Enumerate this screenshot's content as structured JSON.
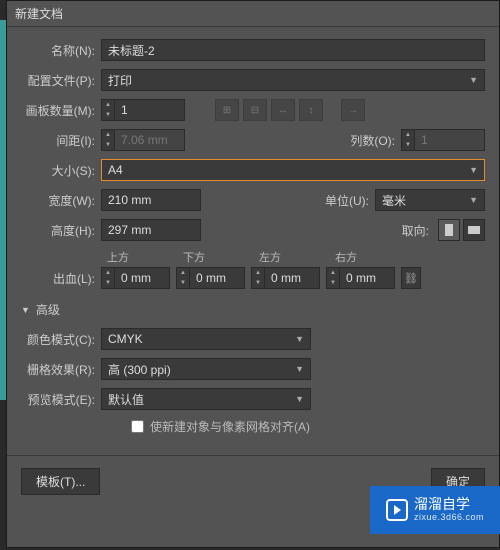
{
  "window": {
    "title": "新建文档"
  },
  "fields": {
    "name_label": "名称(N):",
    "name_value": "未标题-2",
    "profile_label": "配置文件(P):",
    "profile_value": "打印",
    "artboards_label": "画板数量(M):",
    "artboards_value": "1",
    "spacing_label": "间距(I):",
    "spacing_value": "7.06 mm",
    "columns_label": "列数(O):",
    "columns_value": "1",
    "size_label": "大小(S):",
    "size_value": "A4",
    "width_label": "宽度(W):",
    "width_value": "210 mm",
    "units_label": "单位(U):",
    "units_value": "毫米",
    "height_label": "高度(H):",
    "height_value": "297 mm",
    "orient_label": "取向:",
    "bleed_label": "出血(L):",
    "bleed_top_label": "上方",
    "bleed_bottom_label": "下方",
    "bleed_left_label": "左方",
    "bleed_right_label": "右方",
    "bleed_top": "0 mm",
    "bleed_bottom": "0 mm",
    "bleed_left": "0 mm",
    "bleed_right": "0 mm"
  },
  "advanced": {
    "header": "高级",
    "color_mode_label": "颜色模式(C):",
    "color_mode_value": "CMYK",
    "raster_label": "栅格效果(R):",
    "raster_value": "高 (300 ppi)",
    "preview_label": "预览模式(E):",
    "preview_value": "默认值",
    "align_label": "使新建对象与像素网格对齐(A)"
  },
  "footer": {
    "template": "模板(T)...",
    "ok": "确定"
  },
  "watermark": {
    "brand": "溜溜自学",
    "url": "zixue.3d66.com"
  }
}
